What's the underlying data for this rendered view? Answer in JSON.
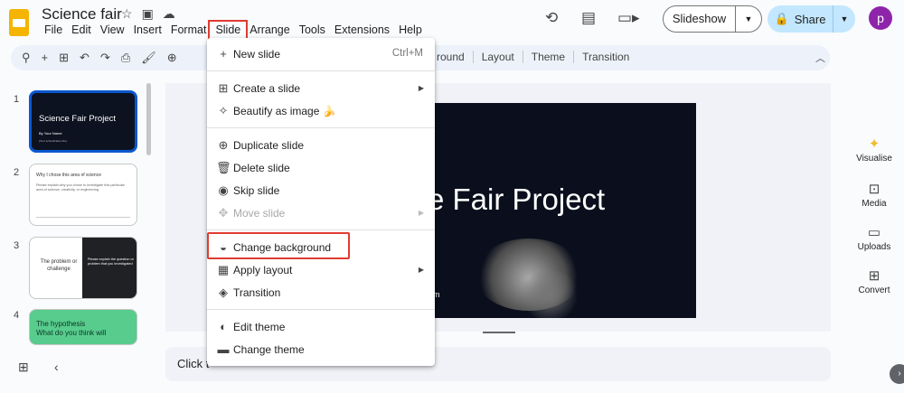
{
  "app": {
    "title": "Science fair",
    "menus": [
      "File",
      "Edit",
      "View",
      "Insert",
      "Format",
      "Slide",
      "Arrange",
      "Tools",
      "Extensions",
      "Help"
    ],
    "slideshow_label": "Slideshow",
    "share_label": "Share",
    "avatar_letter": "p"
  },
  "toolbar": {
    "text_items": [
      "round",
      "Layout",
      "Theme",
      "Transition"
    ]
  },
  "slide_menu": {
    "items": [
      {
        "icon": "plus-icon",
        "label": "New slide",
        "shortcut": "Ctrl+M"
      },
      {
        "icon": "add-slide-icon",
        "label": "Create a slide",
        "submenu": true
      },
      {
        "icon": "magic-wand-icon",
        "label": "Beautify as image 🍌"
      },
      {
        "icon": "duplicate-icon",
        "label": "Duplicate slide"
      },
      {
        "icon": "trash-icon",
        "label": "Delete slide"
      },
      {
        "icon": "eye-icon",
        "label": "Skip slide"
      },
      {
        "icon": "move-icon",
        "label": "Move slide",
        "submenu": true,
        "disabled": true
      },
      {
        "icon": "fill-drip-icon",
        "label": "Change background"
      },
      {
        "icon": "layout-icon",
        "label": "Apply layout",
        "submenu": true
      },
      {
        "icon": "transition-icon",
        "label": "Transition"
      },
      {
        "icon": "palette-icon",
        "label": "Edit theme"
      },
      {
        "icon": "paint-roller-icon",
        "label": "Change theme"
      }
    ]
  },
  "filmstrip": {
    "slides": [
      {
        "number": "1",
        "title": "Science Fair Project",
        "subtitle": "By Your Name",
        "footer": "[Your school/class info]"
      },
      {
        "number": "2",
        "title": "Why I chose this area of science",
        "body": "Please explain why you chose to investigate this particular area of science, creativity, or engineering."
      },
      {
        "number": "3",
        "title": "The problem or challenge",
        "body": "Please explain the question or problem that you investigated"
      },
      {
        "number": "4",
        "title": "The hypothesis",
        "subtitle": "What do you think will"
      }
    ]
  },
  "main_slide": {
    "title": "e Fair Project",
    "subtitle": "m"
  },
  "notes": {
    "text": "Click t"
  },
  "side_panel": {
    "items": [
      "Visualise",
      "Media",
      "Uploads",
      "Convert"
    ]
  }
}
